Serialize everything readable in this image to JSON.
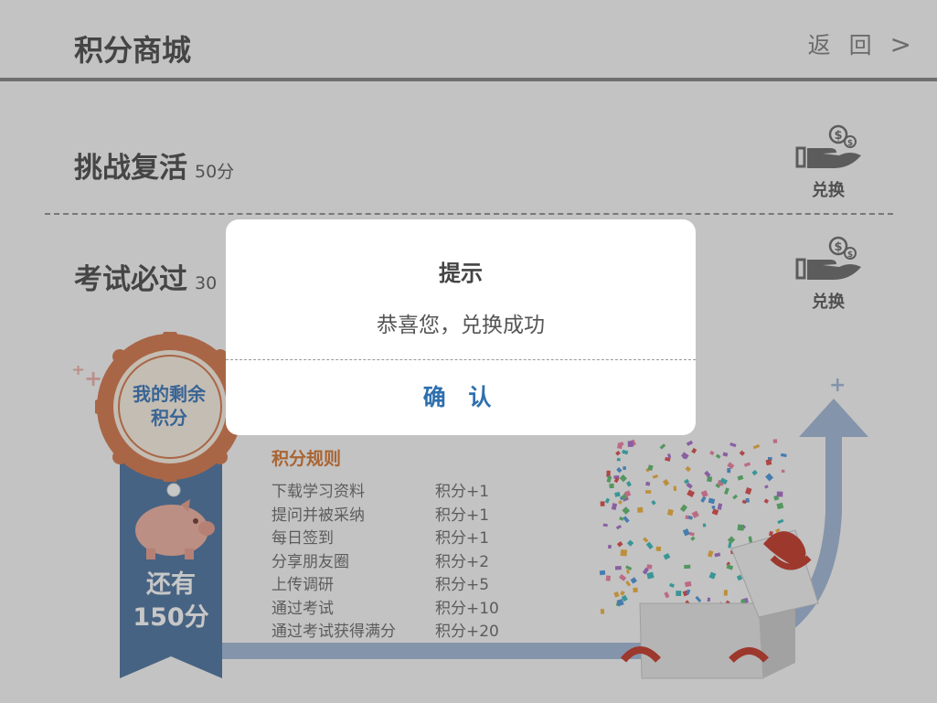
{
  "header": {
    "title": "积分商城",
    "back_label": "返 回",
    "back_icon": ">"
  },
  "items": [
    {
      "name": "挑战复活",
      "cost": "50分",
      "action": "兑换"
    },
    {
      "name": "考试必过",
      "cost": "30",
      "action": "兑换"
    }
  ],
  "badge": {
    "label_line1": "我的剩余",
    "label_line2": "积分",
    "remain_line1": "还有",
    "remain_line2": "150分"
  },
  "rules": {
    "title": "积分规则",
    "list": [
      {
        "name": "下载学习资料",
        "points": "积分+1"
      },
      {
        "name": "提问并被采纳",
        "points": "积分+1"
      },
      {
        "name": "每日签到",
        "points": "积分+1"
      },
      {
        "name": "分享朋友圈",
        "points": "积分+2"
      },
      {
        "name": "上传调研",
        "points": "积分+5"
      },
      {
        "name": "通过考试",
        "points": "积分+10"
      },
      {
        "name": "通过考试获得满分",
        "points": "积分+20"
      }
    ]
  },
  "dialog": {
    "title": "提示",
    "message": "恭喜您，兑换成功",
    "confirm_label": "确 认"
  },
  "colors": {
    "accent_orange": "#d98040",
    "ribbon_blue": "#5b7fa8",
    "confirm_blue": "#2e6fae"
  }
}
